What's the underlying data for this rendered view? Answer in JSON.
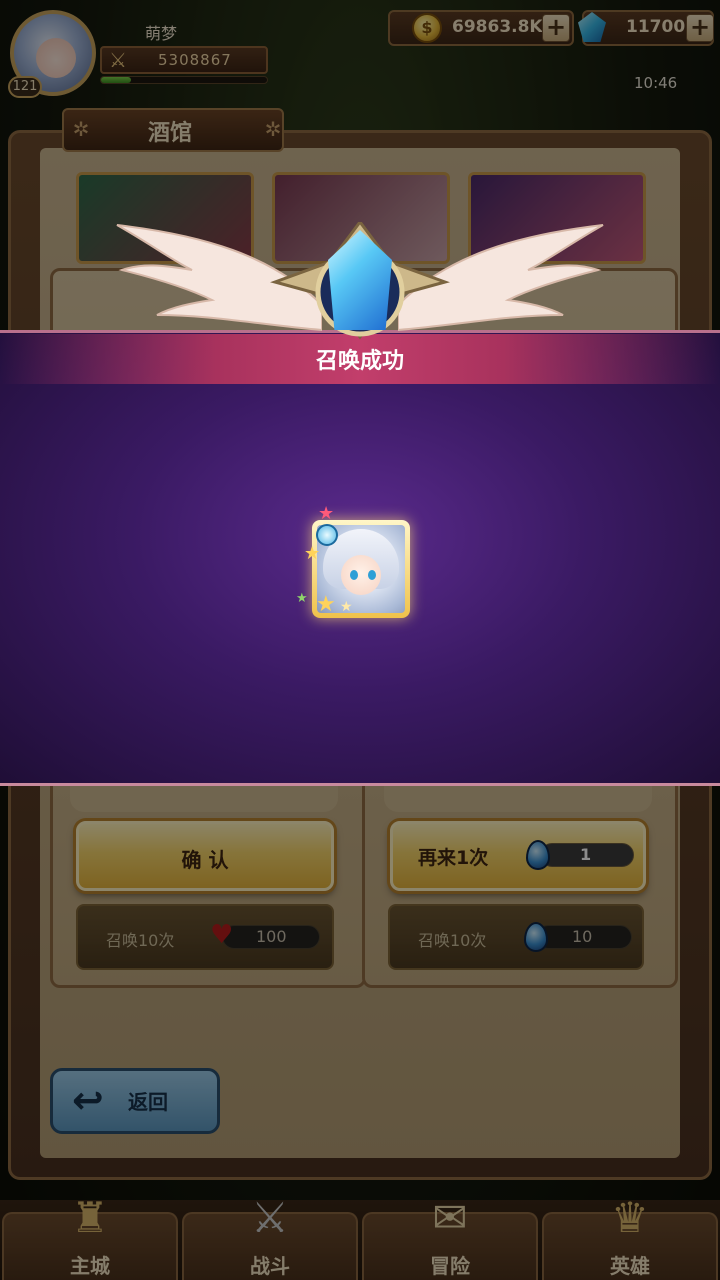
{
  "player": {
    "name": "萌梦",
    "level": "121",
    "power": "5308867",
    "exp_fraction": 0.18
  },
  "resources": {
    "gold": "69863.8K",
    "gems": "11700",
    "plus": "+"
  },
  "clock": "10:46",
  "tavern": {
    "title": "酒馆",
    "help": "?",
    "left": {
      "confirm_label": "确 认",
      "summon10_label": "召唤10次",
      "summon10_cost": "100",
      "cost_icon": "heart-icon"
    },
    "right": {
      "again_label": "再来1次",
      "again_cost": "1",
      "summon10_label": "召唤10次",
      "summon10_cost": "10",
      "cost_icon": "egg-icon"
    },
    "back_label": "返回"
  },
  "modal": {
    "title": "召唤成功"
  },
  "nav": {
    "items": [
      {
        "label": "主城",
        "icon": "castle-icon"
      },
      {
        "label": "战斗",
        "icon": "crossed-swords-icon"
      },
      {
        "label": "冒险",
        "icon": "scroll-icon"
      },
      {
        "label": "英雄",
        "icon": "helmet-icon"
      }
    ]
  },
  "colors": {
    "modal_bg": "#3a1a63",
    "title_bar": "#c23e6b",
    "gold_button": "#f5d46a"
  }
}
